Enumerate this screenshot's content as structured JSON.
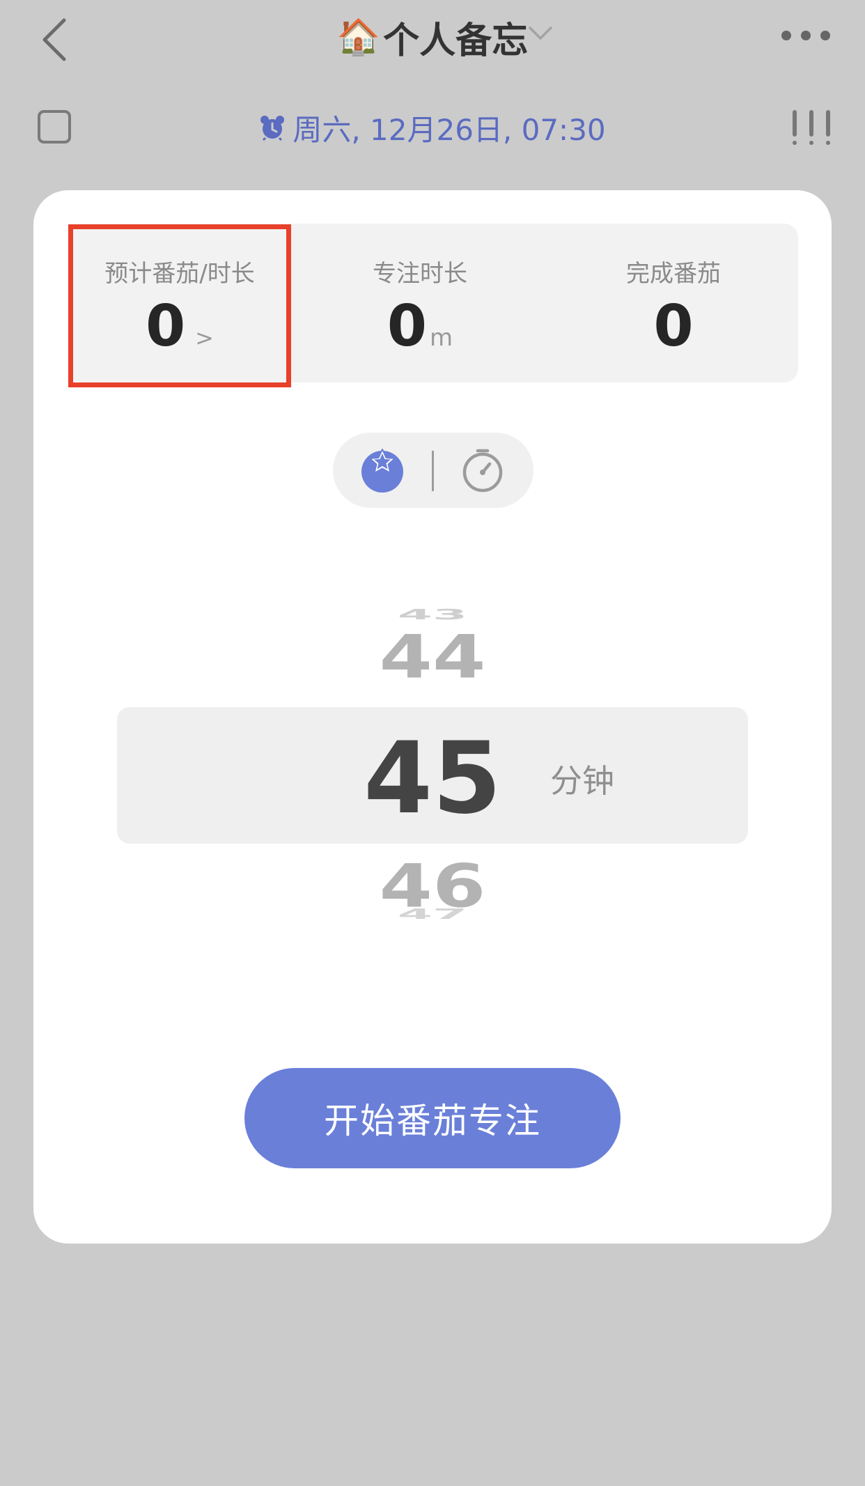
{
  "header": {
    "title_emoji": "🏠",
    "title": "个人备忘",
    "icons": [
      "back-chevron-icon",
      "chevron-down-icon",
      "more-icon"
    ]
  },
  "task": {
    "date_text": "周六, 12月26日, 07:30",
    "date_icon": "alarm-clock-icon",
    "priority_icon": "priority-high-icon",
    "accent_color": "#5a6bc0"
  },
  "stats": {
    "estimate": {
      "label": "预计番茄/时长",
      "value": "0",
      "arrow": ">"
    },
    "focus": {
      "label": "专注时长",
      "value": "0",
      "unit": "m"
    },
    "done": {
      "label": "完成番茄",
      "value": "0"
    }
  },
  "mode": {
    "options": [
      "tomato-mode-icon",
      "stopwatch-mode-icon"
    ],
    "selected": "tomato-mode-icon",
    "selected_color": "#6a7fd8"
  },
  "picker": {
    "values": [
      "43",
      "44",
      "45",
      "46",
      "47"
    ],
    "selected": "45",
    "unit": "分钟"
  },
  "start_button": {
    "label": "开始番茄专注",
    "color": "#6a7fd8"
  },
  "highlight_color": "#e8402a"
}
